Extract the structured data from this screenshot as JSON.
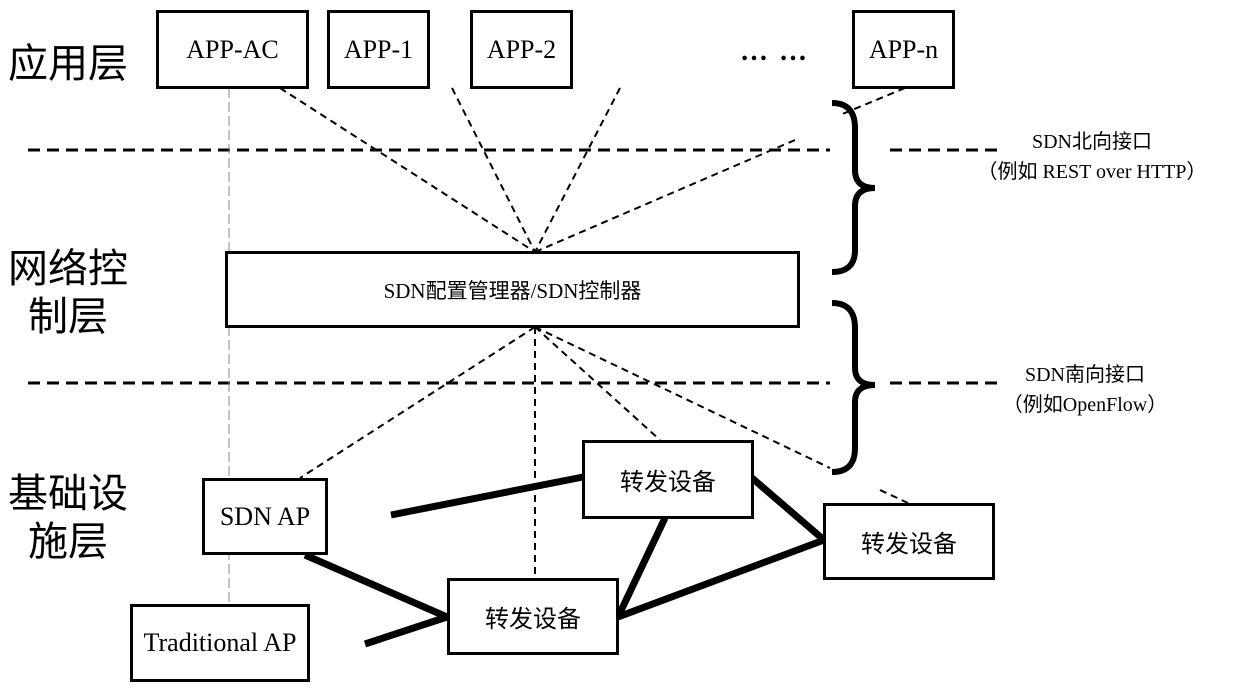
{
  "layers": {
    "application": "应用层",
    "control_line1": "网络控",
    "control_line2": "制层",
    "infra_line1": "基础设",
    "infra_line2": "施层"
  },
  "apps": {
    "app_ac": "APP-AC",
    "app_1": "APP-1",
    "app_2": "APP-2",
    "ellipsis": "… …",
    "app_n": "APP-n"
  },
  "controller": {
    "label": "SDN配置管理器/SDN控制器"
  },
  "interfaces": {
    "northbound": {
      "title": "SDN北向接口",
      "example": "（例如 REST over HTTP）"
    },
    "southbound": {
      "title": "SDN南向接口",
      "example": "（例如OpenFlow）"
    }
  },
  "devices": {
    "sdn_ap": "SDN AP",
    "traditional_ap": "Traditional AP",
    "forwarding_top": "转发设备",
    "forwarding_right": "转发设备",
    "forwarding_bottom": "转发设备"
  }
}
